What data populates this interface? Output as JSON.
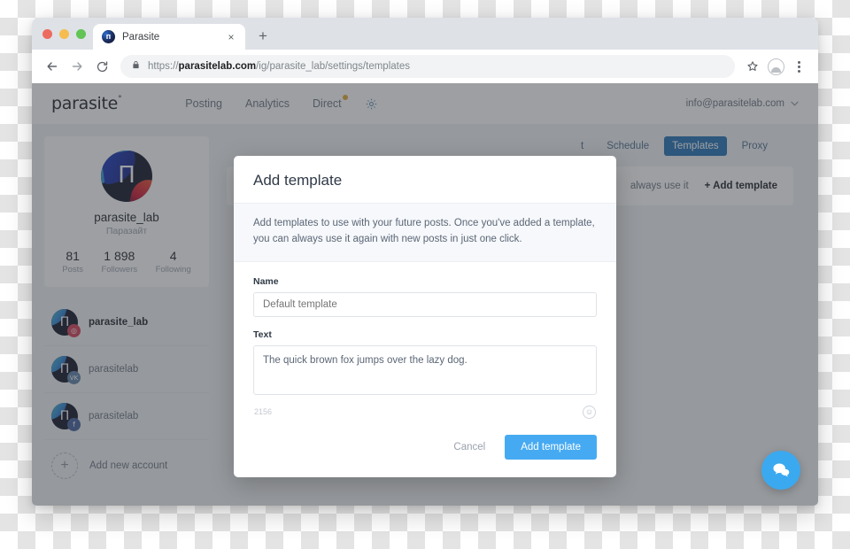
{
  "browser": {
    "tab": {
      "title": "Parasite",
      "favicon": "parasite-favicon",
      "close_label": "×"
    },
    "new_tab_label": "+",
    "url_prefix": "https://",
    "url_domain": "parasitelab.com",
    "url_path": "/ig/parasite_lab/settings/templates",
    "lock_icon": "lock-icon",
    "back_icon": "back-arrow-icon",
    "forward_icon": "forward-arrow-icon",
    "reload_icon": "reload-icon",
    "star_icon": "star-icon",
    "profile_icon": "profile-avatar-icon",
    "menu_icon": "kebab-menu-icon"
  },
  "app": {
    "brand": "parasite",
    "brand_mark": "°",
    "nav": [
      {
        "label": "Posting",
        "badge": false
      },
      {
        "label": "Analytics",
        "badge": false
      },
      {
        "label": "Direct",
        "badge": true
      }
    ],
    "gear_icon": "gear-icon",
    "account_email": "info@parasitelab.com",
    "caret": "∨"
  },
  "profile": {
    "avatar_glyph": "П",
    "username": "parasite_lab",
    "display_name": "Паразайт",
    "stats": [
      {
        "value": "81",
        "label": "Posts"
      },
      {
        "value": "1 898",
        "label": "Followers"
      },
      {
        "value": "4",
        "label": "Following"
      }
    ]
  },
  "accounts": [
    {
      "name": "parasite_lab",
      "network": "instagram",
      "badge": "◎",
      "active": true
    },
    {
      "name": "parasitelab",
      "network": "vk",
      "badge": "VK",
      "active": false
    },
    {
      "name": "parasitelab",
      "network": "facebook",
      "badge": "f",
      "active": false
    }
  ],
  "add_account": {
    "label": "Add new account",
    "icon": "plus-icon"
  },
  "settings": {
    "tabs": [
      {
        "label": "t",
        "active": false
      },
      {
        "label": "Schedule",
        "active": false
      },
      {
        "label": "Templates",
        "active": true
      },
      {
        "label": "Proxy",
        "active": false
      }
    ],
    "panel_hint": "always use it",
    "add_template_label": "+ Add template"
  },
  "modal": {
    "title": "Add template",
    "info": "Add templates to use with your future posts. Once you've added a template, you can always use it again with new posts in just one click.",
    "name_label": "Name",
    "name_placeholder": "Default template",
    "name_value": "",
    "text_label": "Text",
    "text_value": "The quick brown fox jumps over the lazy dog.",
    "char_count": "2156",
    "emoji_icon": "emoji-smiley-icon",
    "cancel_label": "Cancel",
    "submit_label": "Add template"
  },
  "chat_widget": {
    "icon": "chat-bubble-icon"
  },
  "colors": {
    "primary_blue": "#46aaf2",
    "tab_active_blue": "#1f6fb5",
    "badge_amber": "#e0a82e",
    "overlay": "rgba(60,64,70,0.50)"
  }
}
